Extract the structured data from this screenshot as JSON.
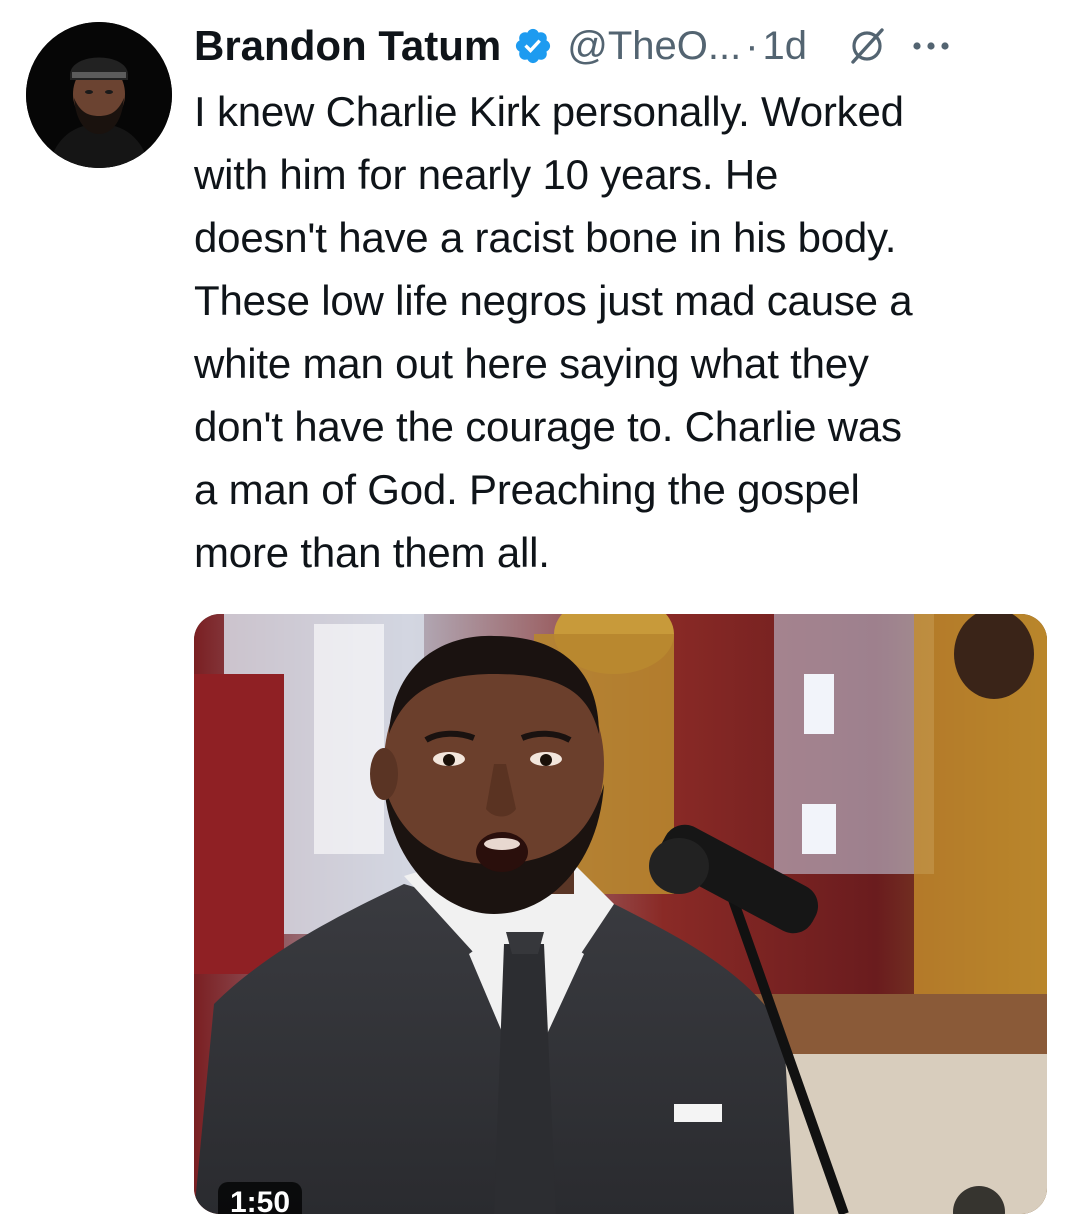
{
  "tweet": {
    "author": {
      "display_name": "Brandon Tatum",
      "handle": "@TheO...",
      "verified": true,
      "avatar_icon": "profile-photo"
    },
    "separator": "·",
    "time": "1d",
    "text": "I knew Charlie Kirk personally. Worked\nwith him for nearly 10 years. He\ndoesn't have a racist bone in his body.\nThese low life negros just mad cause a\nwhite man out here saying what they\ndon't have the courage to. Charlie was\na man of God. Preaching the gospel\nmore than them all.",
    "media": {
      "type": "video",
      "duration": "1:50"
    },
    "icons": {
      "verified": "verified-badge-icon",
      "grok": "grok-icon",
      "more": "more-options-icon"
    },
    "colors": {
      "verified_blue": "#1d9bf0",
      "secondary_text": "#536471",
      "primary_text": "#0f1419"
    }
  }
}
